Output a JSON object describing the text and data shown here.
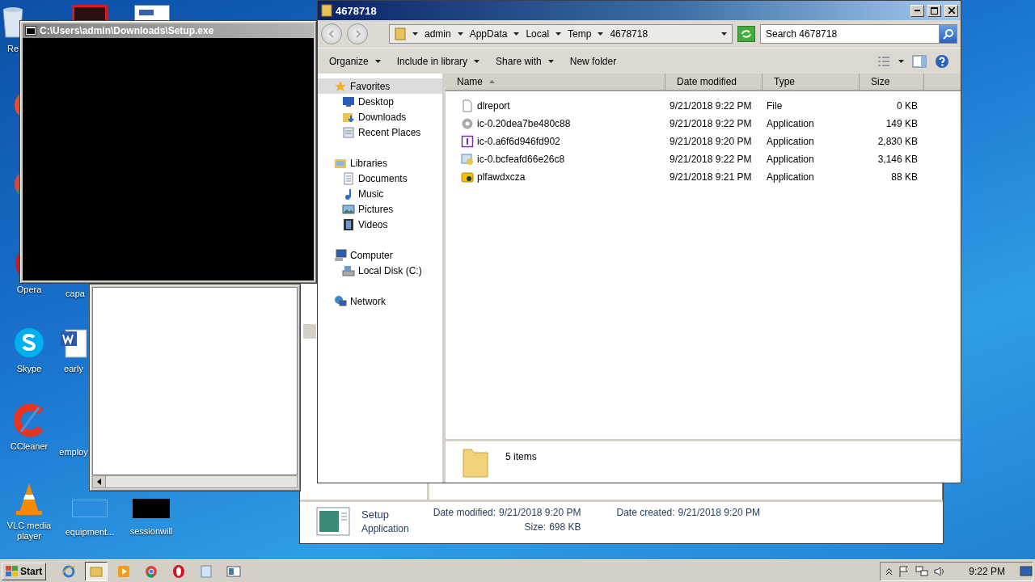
{
  "desktop_icons": [
    {
      "kind": "recycle",
      "label": "Re"
    },
    {
      "kind": "redbox"
    },
    {
      "kind": "document"
    },
    {
      "kind": "firefox"
    },
    {
      "kind": "chrome"
    },
    {
      "kind": "opera",
      "label": "Opera"
    },
    {
      "kind": "covered",
      "label": "capa"
    },
    {
      "kind": "skype",
      "label": "Skype"
    },
    {
      "kind": "word",
      "label": "early"
    },
    {
      "kind": "ccleaner",
      "label": "CCleaner"
    },
    {
      "kind": "covered",
      "label": "employ"
    },
    {
      "kind": "vlc",
      "label": "VLC media player"
    },
    {
      "kind": "blank",
      "label": "equipment..."
    },
    {
      "kind": "black",
      "label": "sessionwill"
    }
  ],
  "console_window": {
    "title": "C:\\Users\\admin\\Downloads\\Setup.exe"
  },
  "background_window": {
    "scrollbar": true
  },
  "explorer": {
    "title": "4678718",
    "breadcrumb": [
      "admin",
      "AppData",
      "Local",
      "Temp",
      "4678718"
    ],
    "search": {
      "placeholder": "Search 4678718"
    },
    "toolbar": [
      {
        "label": "Organize",
        "menu": true
      },
      {
        "label": "Include in library",
        "menu": true
      },
      {
        "label": "Share with",
        "menu": true
      },
      {
        "label": "New folder",
        "menu": false
      }
    ],
    "nav": [
      {
        "kind": "favorites",
        "label": "Favorites",
        "selected": true,
        "children": [
          {
            "kind": "desktop",
            "label": "Desktop",
            "selected": false
          },
          {
            "kind": "downloads",
            "label": "Downloads",
            "selected": false
          },
          {
            "kind": "recent",
            "label": "Recent Places",
            "selected": false
          }
        ]
      },
      {
        "kind": "libraries",
        "label": "Libraries",
        "selected": false,
        "children": [
          {
            "kind": "documents",
            "label": "Documents",
            "selected": false
          },
          {
            "kind": "music",
            "label": "Music",
            "selected": false
          },
          {
            "kind": "pictures",
            "label": "Pictures",
            "selected": false
          },
          {
            "kind": "videos",
            "label": "Videos",
            "selected": false
          }
        ]
      },
      {
        "kind": "computer",
        "label": "Computer",
        "selected": false,
        "children": [
          {
            "kind": "disk",
            "label": "Local Disk (C:)",
            "selected": false
          }
        ]
      },
      {
        "kind": "network",
        "label": "Network",
        "selected": false
      }
    ],
    "columns": [
      {
        "label": "Name",
        "sorted": true
      },
      {
        "label": "Date modified",
        "sorted": false
      },
      {
        "label": "Type",
        "sorted": false
      },
      {
        "label": "Size",
        "sorted": false
      }
    ],
    "files": [
      {
        "kind": "file",
        "name": "dlreport",
        "date": "9/21/2018 9:22 PM",
        "type": "File",
        "size": "0 KB"
      },
      {
        "kind": "gear",
        "name": "ic-0.20dea7be480c88",
        "date": "9/21/2018 9:22 PM",
        "type": "Application",
        "size": "149 KB"
      },
      {
        "kind": "purple",
        "name": "ic-0.a6f6d946fd902",
        "date": "9/21/2018 9:20 PM",
        "type": "Application",
        "size": "2,830 KB"
      },
      {
        "kind": "installer",
        "name": "ic-0.bcfeafd66e26c8",
        "date": "9/21/2018 9:22 PM",
        "type": "Application",
        "size": "3,146 KB"
      },
      {
        "kind": "yellow",
        "name": "plfawdxcza",
        "date": "9/21/2018 9:21 PM",
        "type": "Application",
        "size": "88 KB"
      }
    ],
    "status": "5 items"
  },
  "details": {
    "name": "Setup",
    "type": "Application",
    "fields": [
      {
        "label": "Date modified:",
        "value": "9/21/2018 9:20 PM"
      },
      {
        "label": "Size:",
        "value": "698 KB"
      },
      {
        "label": "Date created:",
        "value": "9/21/2018 9:20 PM"
      }
    ]
  },
  "taskbar": {
    "start": "Start",
    "apps": [
      {
        "kind": "ie",
        "selected": false
      },
      {
        "kind": "explorer",
        "selected": true
      },
      {
        "kind": "media",
        "selected": false
      },
      {
        "kind": "chrome",
        "selected": false
      },
      {
        "kind": "opera",
        "selected": false
      },
      {
        "kind": "notepad",
        "selected": false
      },
      {
        "kind": "window",
        "selected": false
      }
    ],
    "clock": "9:22 PM"
  }
}
